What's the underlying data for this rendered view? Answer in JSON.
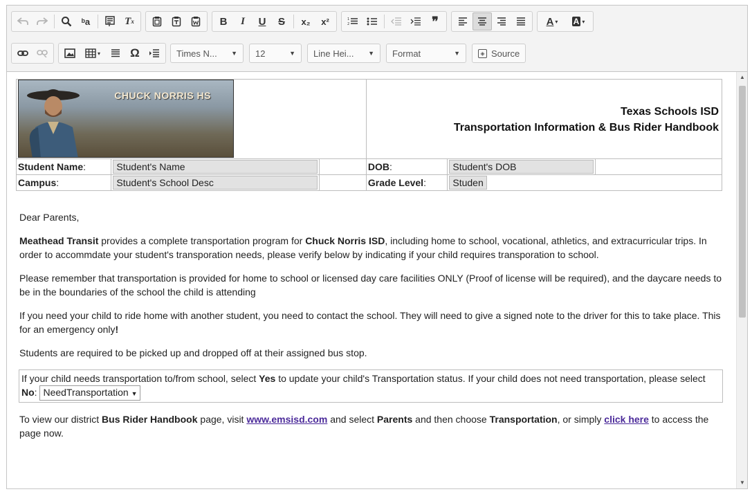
{
  "toolbar": {
    "row1": {
      "undo": "undo-icon",
      "redo": "redo-icon",
      "find": "search-icon",
      "replace": "find-replace-icon",
      "paste_word": "paste-word-icon",
      "clear_format": "clear-format-icon",
      "paste": "paste-icon",
      "paste_text": "paste-text-icon",
      "paste_from_word": "paste-word-doc-icon",
      "bold_label": "B",
      "italic_label": "I",
      "underline_label": "U",
      "strike_label": "S",
      "subscript_label": "x₂",
      "superscript_label": "x²",
      "numbered_list": "numbered-list-icon",
      "bullet_list": "bullet-list-icon",
      "outdent": "outdent-icon",
      "indent": "indent-icon",
      "blockquote_label": "❞",
      "align_left": "align-left-icon",
      "align_center": "align-center-icon",
      "align_right": "align-right-icon",
      "align_justify": "align-justify-icon",
      "text_color_label": "A",
      "bg_color_label": "A"
    },
    "row2": {
      "link": "link-icon",
      "unlink": "unlink-icon",
      "image": "image-icon",
      "table": "table-icon",
      "hr": "horizontal-rule-icon",
      "special_char_label": "Ω",
      "list_style": "list-style-icon",
      "font_family": "Times N...",
      "font_size": "12",
      "line_height": "Line Hei...",
      "format": "Format",
      "source": "Source"
    }
  },
  "document": {
    "logo_text": "CHUCK NORRIS HS",
    "title_line1": "Texas Schools ISD",
    "title_line2": "Transportation Information & Bus Rider Handbook",
    "student_name_label": "Student Name",
    "student_name_value": "Student's Name",
    "dob_label": "DOB",
    "dob_value": "Student's DOB",
    "campus_label": "Campus",
    "campus_value": "Student's School Desc",
    "grade_label": "Grade Level",
    "grade_value": "Studen",
    "greeting": "Dear Parents,",
    "p1_bold1": "Meathead Transit",
    "p1_text1": " provides a complete transportation program for ",
    "p1_bold2": "Chuck Norris ISD",
    "p1_text2": ", including home to school, vocational, athletics, and extracurricular trips. In order to accommdate your student's transporation needs, please verify below by indicating if your child requires transporation to school.",
    "p2": "Please remember that transportation is provided for home to school or licensed day care facilities ONLY (Proof of license will be required), and the daycare needs to be in the boundaries of the school the child is attending",
    "p3_text": "If you need your child to ride home with another student, you need to contact the school. They will need to give a signed note to the driver for this to take place. This for an emergency only",
    "p3_bang": "!",
    "p4": "Students are required to be picked up and dropped off at their assigned bus stop.",
    "callout_text1": "If your child needs transportation to/from school, select ",
    "callout_yes": "Yes",
    "callout_text2": " to update your child's Transportation status. If your child does not need transportation, please select ",
    "callout_no": "No",
    "callout_colon": ": ",
    "select_value": "NeedTransportation",
    "select_caret": "▼",
    "p5_text1": "To view our district ",
    "p5_bold1": "Bus Rider Handbook",
    "p5_text2": " page, visit ",
    "p5_link1": "www.emsisd.com",
    "p5_text3": " and select ",
    "p5_bold2": "Parents",
    "p5_text4": " and then choose ",
    "p5_bold3": "Transportation",
    "p5_text5": ", or simply ",
    "p5_link2": "click here",
    "p5_text6": " to access the page now."
  },
  "colors": {
    "toolbar_bg": "#f3f3f3",
    "border": "#c5c5c5",
    "link": "#4b2a9a",
    "field_bg": "#e2e2e2"
  }
}
